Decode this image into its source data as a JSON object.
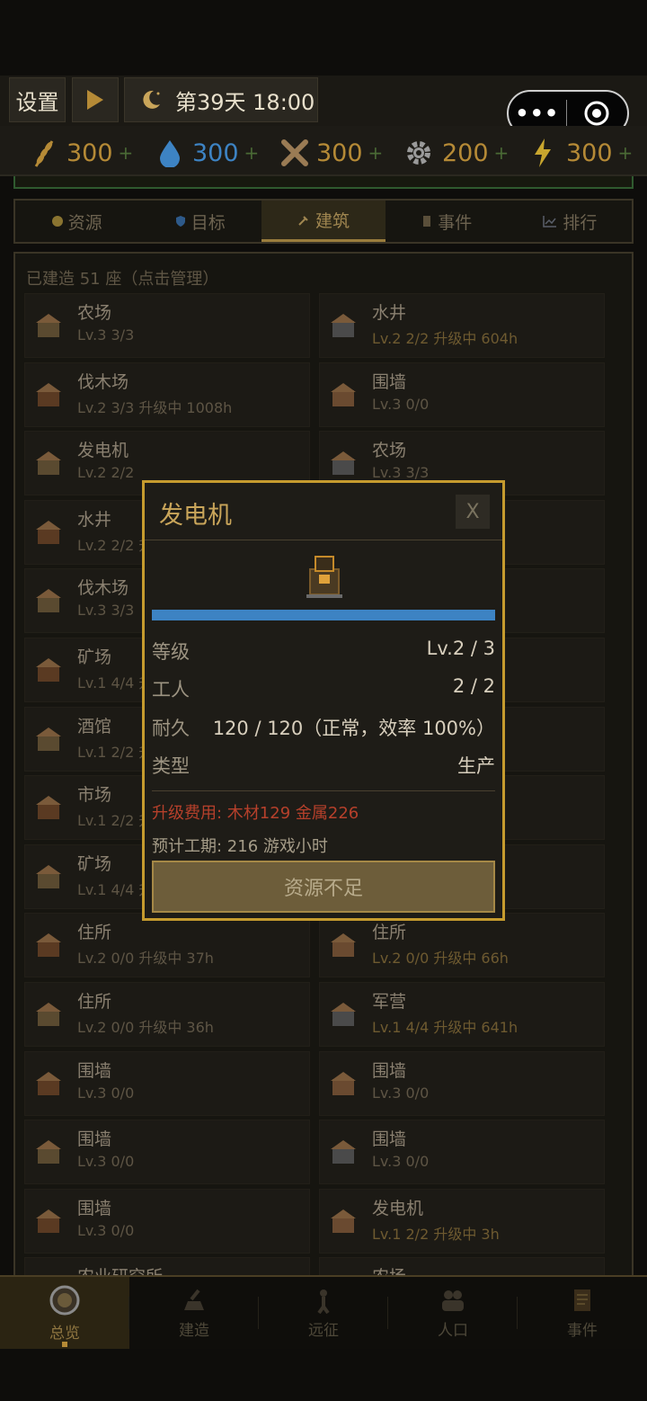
{
  "hud": {
    "settings_label": "设置",
    "day_label": "第39天 18:00"
  },
  "resources": [
    {
      "icon": "wheat-icon",
      "value": "300",
      "plus": "+",
      "color": "#b58a36"
    },
    {
      "icon": "water-drop-icon",
      "value": "300",
      "plus": "+",
      "color": "#3d83c3"
    },
    {
      "icon": "crossed-tools-icon",
      "value": "300",
      "plus": "+",
      "color": "#9a7b54"
    },
    {
      "icon": "gear-icon",
      "value": "200",
      "plus": "+",
      "color": "#9a9a9a"
    },
    {
      "icon": "lightning-icon",
      "value": "300",
      "plus": "+",
      "color": "#c8a62e"
    }
  ],
  "tabs": [
    {
      "label": "资源",
      "icon": "coin-icon"
    },
    {
      "label": "目标",
      "icon": "shield-icon"
    },
    {
      "label": "建筑",
      "icon": "hammer-icon",
      "active": true
    },
    {
      "label": "事件",
      "icon": "scroll-icon"
    },
    {
      "label": "排行",
      "icon": "chart-icon"
    }
  ],
  "panel": {
    "count_label": "已建造 51 座（点击管理）",
    "buildings": [
      {
        "name": "农场",
        "level": "Lv.3 3/3",
        "upgrading": false
      },
      {
        "name": "水井",
        "level": "Lv.2 2/2 升级中 604h",
        "upgrading": true
      },
      {
        "name": "伐木场",
        "level": "Lv.2 3/3 升级中 1008h",
        "upgrading": false
      },
      {
        "name": "围墙",
        "level": "Lv.3 0/0",
        "upgrading": false
      },
      {
        "name": "发电机",
        "level": "Lv.2 2/2",
        "upgrading": false
      },
      {
        "name": "农场",
        "level": "Lv.3 3/3",
        "upgrading": false
      },
      {
        "name": "水井",
        "level": "Lv.2 2/2 升",
        "upgrading": false
      },
      {
        "name": "",
        "level": "",
        "upgrading": false
      },
      {
        "name": "伐木场",
        "level": "Lv.3 3/3",
        "upgrading": false
      },
      {
        "name": "",
        "level": "",
        "upgrading": false
      },
      {
        "name": "矿场",
        "level": "Lv.1 4/4 升",
        "upgrading": false
      },
      {
        "name": "",
        "level": "",
        "upgrading": false
      },
      {
        "name": "酒馆",
        "level": "Lv.1 2/2 升",
        "upgrading": false
      },
      {
        "name": "",
        "level": "",
        "upgrading": false
      },
      {
        "name": "市场",
        "level": "Lv.1 2/2 升",
        "upgrading": false
      },
      {
        "name": "",
        "level": "",
        "upgrading": false
      },
      {
        "name": "矿场",
        "level": "Lv.1 4/4 升",
        "upgrading": false
      },
      {
        "name": "",
        "level": "",
        "upgrading": false
      },
      {
        "name": "住所",
        "level": "Lv.2 0/0 升级中 37h",
        "upgrading": false
      },
      {
        "name": "住所",
        "level": "Lv.2 0/0 升级中 66h",
        "upgrading": true
      },
      {
        "name": "住所",
        "level": "Lv.2 0/0 升级中 36h",
        "upgrading": false
      },
      {
        "name": "军营",
        "level": "Lv.1 4/4 升级中 641h",
        "upgrading": true
      },
      {
        "name": "围墙",
        "level": "Lv.3 0/0",
        "upgrading": false
      },
      {
        "name": "围墙",
        "level": "Lv.3 0/0",
        "upgrading": false
      },
      {
        "name": "围墙",
        "level": "Lv.3 0/0",
        "upgrading": false
      },
      {
        "name": "围墙",
        "level": "Lv.3 0/0",
        "upgrading": false
      },
      {
        "name": "围墙",
        "level": "Lv.3 0/0",
        "upgrading": false
      },
      {
        "name": "发电机",
        "level": "Lv.1 2/2 升级中 3h",
        "upgrading": true
      },
      {
        "name": "农业研究所",
        "level": "",
        "upgrading": false
      },
      {
        "name": "农场",
        "level": "",
        "upgrading": false
      }
    ]
  },
  "modal": {
    "title": "发电机",
    "close_label": "X",
    "progress": 1.0,
    "rows": [
      {
        "key": "等级",
        "value": "Lv.2 / 3"
      },
      {
        "key": "工人",
        "value": "2 / 2"
      },
      {
        "key": "耐久",
        "value": "120 / 120（正常，效率 100%）"
      },
      {
        "key": "类型",
        "value": "生产"
      }
    ],
    "cost": "升级费用: 木材129 金属226",
    "eta": "预计工期: 216 游戏小时",
    "action_label": "资源不足"
  },
  "nav": [
    {
      "label": "总览",
      "icon": "overview-icon",
      "active": true
    },
    {
      "label": "建造",
      "icon": "build-icon"
    },
    {
      "label": "远征",
      "icon": "expedition-icon"
    },
    {
      "label": "人口",
      "icon": "population-icon"
    },
    {
      "label": "事件",
      "icon": "event-scroll-icon"
    }
  ]
}
